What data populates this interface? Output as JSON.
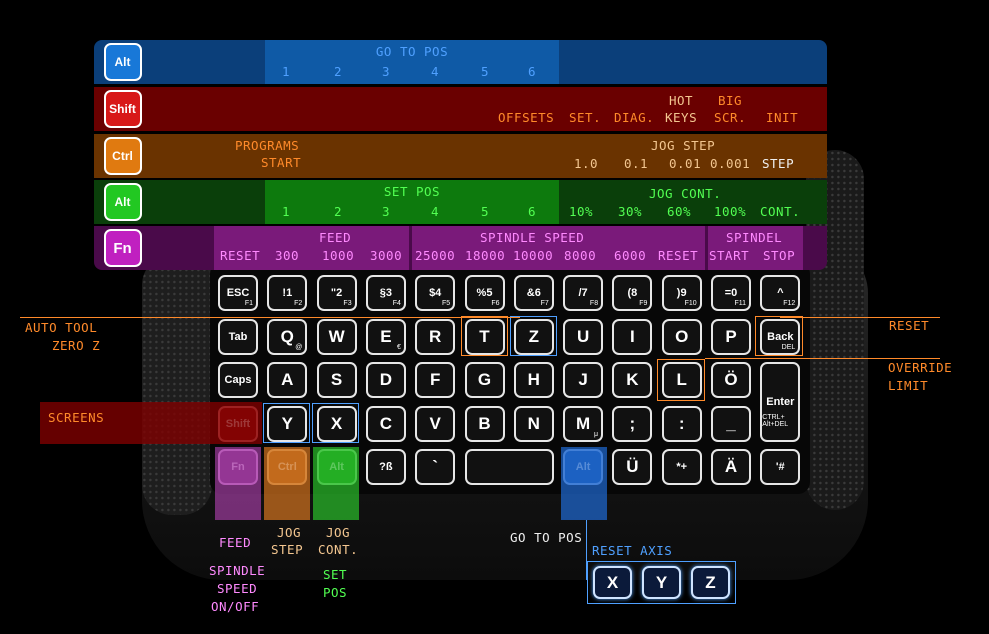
{
  "colors": {
    "blue": "#0b3f7a",
    "red": "#6a0000",
    "orange": "#6a3300",
    "green": "#0a4a0a",
    "purple": "#6a0a6a"
  },
  "rows": {
    "alt_blue": {
      "badge": "Alt",
      "title": "GO TO POS",
      "nums": [
        "1",
        "2",
        "3",
        "4",
        "5",
        "6"
      ]
    },
    "shift": {
      "badge": "Shift",
      "offsets": "OFFSETS",
      "set": "SET.",
      "diag": "DIAG.",
      "hot1": "HOT",
      "hot2": "KEYS",
      "big1": "BIG",
      "big2": "SCR.",
      "init": "INIT"
    },
    "ctrl": {
      "badge": "Ctrl",
      "prog1": "PROGRAMS",
      "prog2": "START",
      "jog_title": "JOG STEP",
      "steps": [
        "1.0",
        "0.1",
        "0.01",
        "0.001",
        "STEP"
      ]
    },
    "alt_green": {
      "badge": "Alt",
      "set_title": "SET POS",
      "nums": [
        "1",
        "2",
        "3",
        "4",
        "5",
        "6"
      ],
      "jog_title": "JOG CONT.",
      "vals": [
        "10%",
        "30%",
        "60%",
        "100%",
        "CONT."
      ]
    },
    "fn": {
      "badge": "Fn",
      "reset": "RESET",
      "feed_title": "FEED",
      "feeds": [
        "300",
        "1000",
        "3000"
      ],
      "spindle_title": "SPINDLE SPEED",
      "speeds": [
        "25000",
        "18000",
        "10000",
        "8000",
        "6000"
      ],
      "reset2": "RESET",
      "spindel_title": "SPINDEL",
      "start": "START",
      "stop": "STOP"
    }
  },
  "keys": {
    "row1": [
      {
        "k": "ESC",
        "s": "F1"
      },
      {
        "k": "!1",
        "s": "F2"
      },
      {
        "k": "\"2",
        "s": "F3"
      },
      {
        "k": "§3",
        "s": "F4"
      },
      {
        "k": "$4",
        "s": "F5"
      },
      {
        "k": "%5",
        "s": "F6"
      },
      {
        "k": "&6",
        "s": "F7"
      },
      {
        "k": "/7",
        "s": "F8"
      },
      {
        "k": "(8",
        "s": "F9"
      },
      {
        "k": ")9",
        "s": "F10"
      },
      {
        "k": "=0",
        "s": "F11"
      },
      {
        "k": "^",
        "s": "F12"
      }
    ],
    "row2": [
      "Tab",
      "Q",
      "W",
      "E",
      "R",
      "T",
      "Z",
      "U",
      "I",
      "O",
      "P",
      "Back"
    ],
    "row3": [
      "Caps",
      "A",
      "S",
      "D",
      "F",
      "G",
      "H",
      "J",
      "K",
      "L",
      "Ö",
      "Enter"
    ],
    "row4": [
      "Shift",
      "Y",
      "X",
      "C",
      "V",
      "B",
      "N",
      "M",
      ";",
      ":",
      "_",
      ""
    ],
    "row5": [
      "Fn",
      "Ctrl",
      "Alt",
      "?ß",
      "`",
      "",
      "",
      "Alt",
      "Ü",
      "*+",
      "Ä",
      "'#"
    ],
    "row4_enter_sub": "CTRL+ Alt+DEL",
    "back_sub": "DEL",
    "q_sub": "@",
    "e_sub": "€",
    "m_sub": "μ"
  },
  "callouts": {
    "auto_tool_1": "AUTO TOOL",
    "auto_tool_2": "ZERO Z",
    "screens": "SCREENS",
    "reset_right": "RESET",
    "override_1": "OVERRIDE",
    "override_2": "LIMIT",
    "feed": "FEED",
    "spindle_1": "SPINDLE",
    "spindle_2": "SPEED",
    "spindle_3": "ON/OFF",
    "jog_step_1": "JOG",
    "jog_step_2": "STEP",
    "jog_cont_1": "JOG",
    "jog_cont_2": "CONT.",
    "set_pos_1": "SET",
    "set_pos_2": "POS",
    "go_to_pos": "GO TO POS",
    "reset_axis": "RESET AXIS",
    "axis_keys": [
      "X",
      "Y",
      "Z"
    ]
  }
}
